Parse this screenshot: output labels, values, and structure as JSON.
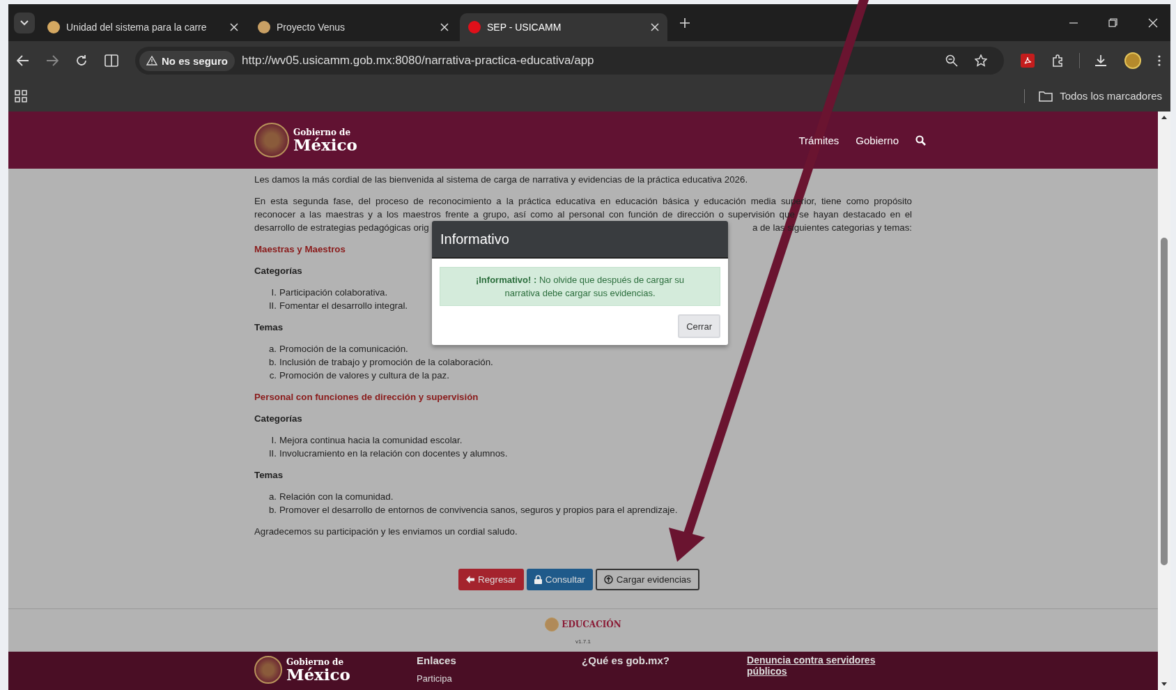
{
  "browser": {
    "tabs": [
      {
        "title": "Unidad del sistema para la carre",
        "selected": false,
        "color": "#d4a861"
      },
      {
        "title": "Proyecto Venus",
        "selected": false,
        "color": "#c9a064"
      },
      {
        "title": "SEP - USICAMM",
        "selected": true,
        "color": "#e0101a"
      }
    ],
    "security_label": "No es seguro",
    "url": "http://wv05.usicamm.gob.mx:8080/narrativa-practica-educativa/app",
    "bookmarks_label": "Todos los marcadores"
  },
  "header": {
    "logo_small": "Gobierno de",
    "logo_large": "México",
    "nav": [
      "Trámites",
      "Gobierno"
    ]
  },
  "content": {
    "intro": "Les damos la más cordial de las bienvenida al sistema de carga de narrativa y evidencias de la práctica educativa 2026.",
    "paragraph_lines": [
      "En esta segunda fase, del proceso de reconocimiento a la práctica educativa en educación básica y educación media superior, tiene como propósito",
      "reconocer a las maestras y a los maestros frente a grupo, así como al personal con función de dirección o supervisión que se hayan destacado en el"
    ],
    "paragraph_last_parts": [
      "desarrollo de estrategias pedagógicas orig",
      "a de las siguientes categorias y temas:"
    ],
    "sections": [
      {
        "heading": "Maestras y Maestros",
        "groups": [
          {
            "title": "Categorías",
            "items": [
              {
                "marker": "I.",
                "text": "Participación colaborativa."
              },
              {
                "marker": "II.",
                "text": "Fomentar el desarrollo integral."
              }
            ]
          },
          {
            "title": "Temas",
            "items": [
              {
                "marker": "a.",
                "text": "Promoción de la comunicación."
              },
              {
                "marker": "b.",
                "text": "Inclusión de trabajo y promoción de la colaboración."
              },
              {
                "marker": "c.",
                "text": "Promoción de valores y cultura de la paz."
              }
            ]
          }
        ]
      },
      {
        "heading": "Personal con funciones de dirección y supervisión",
        "groups": [
          {
            "title": "Categorías",
            "items": [
              {
                "marker": "I.",
                "text": "Mejora continua hacia la comunidad escolar."
              },
              {
                "marker": "II.",
                "text": "Involucramiento en la relación con docentes y alumnos."
              }
            ]
          },
          {
            "title": "Temas",
            "items": [
              {
                "marker": "a.",
                "text": "Relación con la comunidad."
              },
              {
                "marker": "b.",
                "text": "Promover el desarrollo de entornos de convivencia sanos, seguros y propios para el aprendizaje."
              }
            ]
          }
        ]
      }
    ],
    "closing": "Agradecemos su participación y les enviamos un cordial saludo."
  },
  "actions": [
    {
      "label": "Regresar",
      "kind": "back"
    },
    {
      "label": "Consultar",
      "kind": "lock"
    },
    {
      "label": "Cargar evidencias",
      "kind": "upload"
    }
  ],
  "footer": {
    "brand": "EDUCACIÓN",
    "version": "v1.7.1",
    "logo_small": "Gobierno de",
    "logo_large": "México",
    "columns": [
      {
        "title": "Enlaces",
        "links": [
          "Participa"
        ]
      },
      {
        "title": "¿Qué es gob.mx?"
      },
      {
        "title": "Denuncia contra servidores públicos"
      }
    ]
  },
  "dialog": {
    "title": "Informativo",
    "message": "**¡Informativo! :** No olvide que después de cargar su narrativa debe cargar sus evidencias.",
    "button": "Cerrar"
  }
}
